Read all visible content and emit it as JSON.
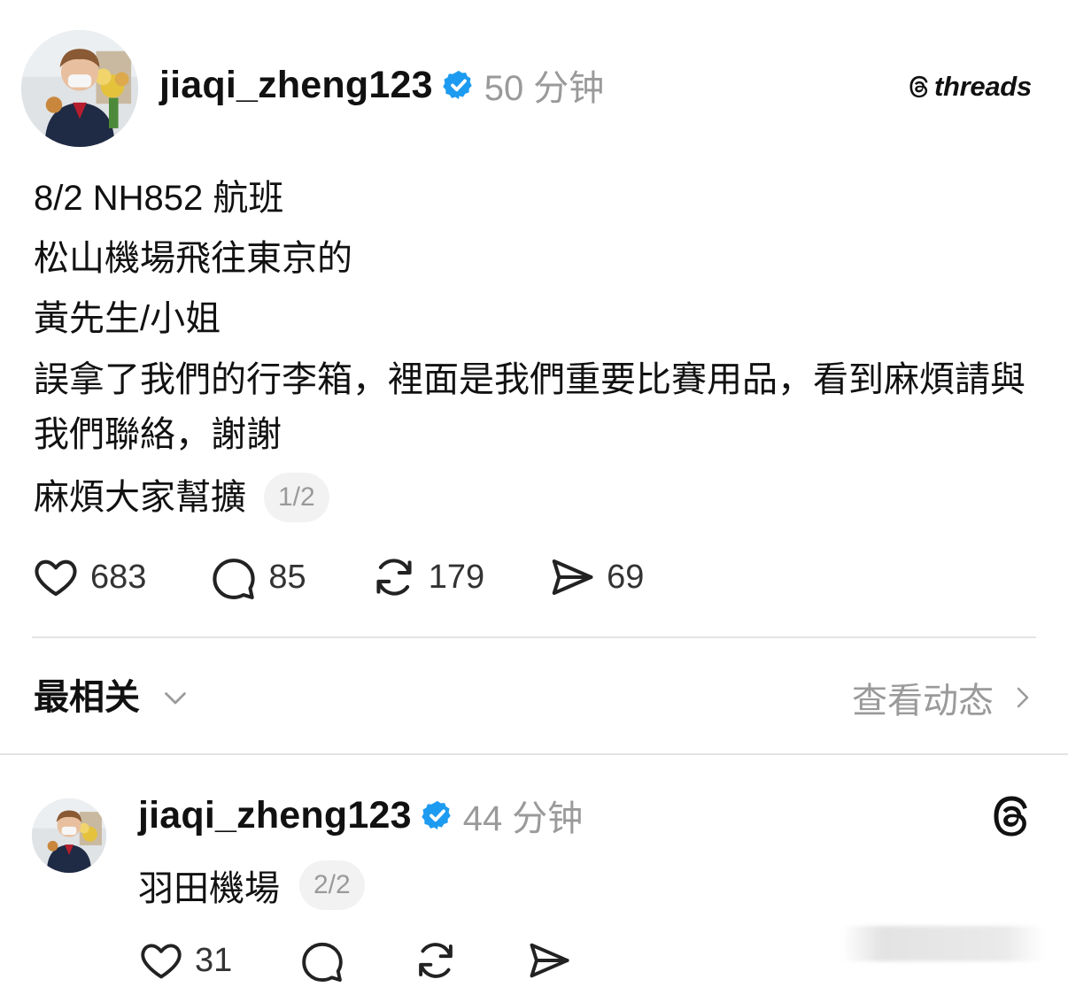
{
  "post": {
    "username": "jiaqi_zheng123",
    "time": "50 分钟",
    "brand": "threads",
    "lines": [
      "8/2 NH852 航班",
      "松山機場飛往東京的",
      "黃先生/小姐",
      "誤拿了我們的行李箱，裡面是我們重要比賽用品，看到麻煩請與我們聯絡，謝謝",
      "麻煩大家幫擴"
    ],
    "page": "1/2",
    "likes": "683",
    "comments": "85",
    "reposts": "179",
    "shares": "69"
  },
  "sort": {
    "label": "最相关",
    "activity": "查看动态"
  },
  "reply": {
    "username": "jiaqi_zheng123",
    "time": "44 分钟",
    "text": "羽田機場",
    "page": "2/2",
    "likes": "31"
  },
  "colors": {
    "verified": "#1d9bf0",
    "muted": "#9a9a9a",
    "text": "#111111"
  },
  "icons": {
    "verified": "verified-badge-icon",
    "like": "heart-icon",
    "comment": "speech-bubble-icon",
    "repost": "repost-icon",
    "share": "paper-plane-icon",
    "threads": "threads-logo-icon"
  }
}
